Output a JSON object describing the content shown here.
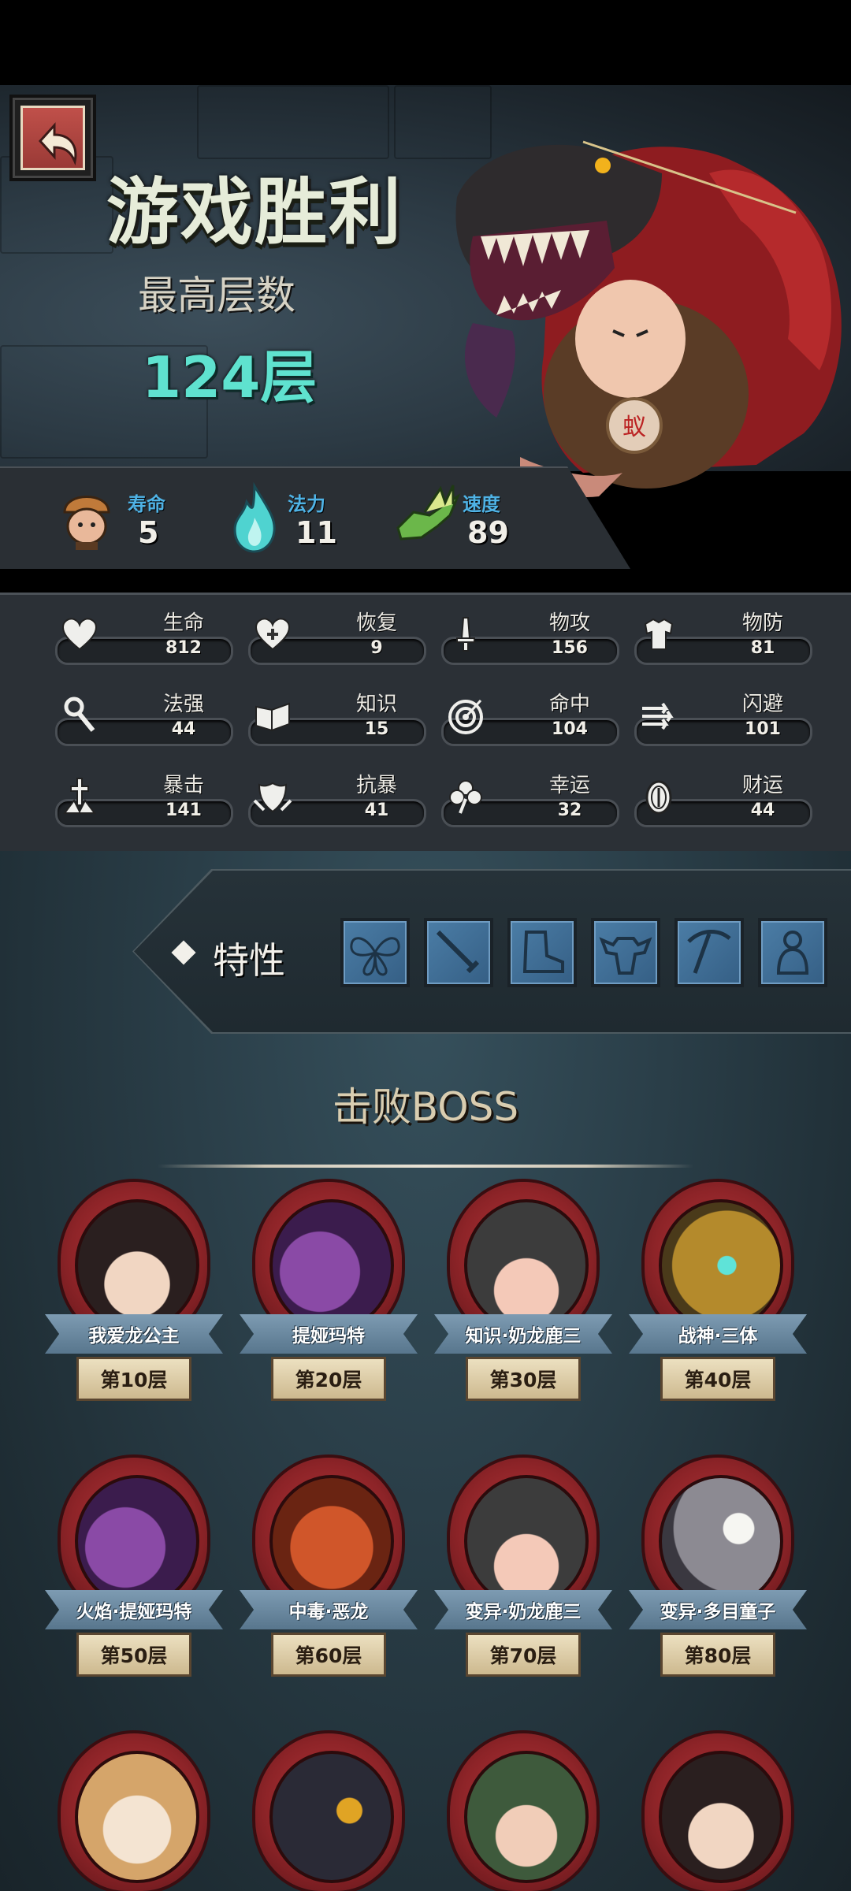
{
  "header": {
    "title": "游戏胜利",
    "floor_label": "最高层数",
    "floor_value": "124层"
  },
  "top_stats": [
    {
      "label": "寿命",
      "value": "5",
      "icon": "helmet-character-icon"
    },
    {
      "label": "法力",
      "value": "11",
      "icon": "blue-flame-icon"
    },
    {
      "label": "速度",
      "value": "89",
      "icon": "winged-boot-icon"
    }
  ],
  "attributes": [
    {
      "label": "生命",
      "value": "812",
      "icon": "heart-icon"
    },
    {
      "label": "恢复",
      "value": "9",
      "icon": "heart-plus-icon"
    },
    {
      "label": "物攻",
      "value": "156",
      "icon": "sword-icon"
    },
    {
      "label": "物防",
      "value": "81",
      "icon": "armor-icon"
    },
    {
      "label": "法强",
      "value": "44",
      "icon": "staff-icon"
    },
    {
      "label": "知识",
      "value": "15",
      "icon": "book-icon"
    },
    {
      "label": "命中",
      "value": "104",
      "icon": "target-icon"
    },
    {
      "label": "闪避",
      "value": "101",
      "icon": "dodge-arrows-icon"
    },
    {
      "label": "暴击",
      "value": "141",
      "icon": "crit-dagger-icon"
    },
    {
      "label": "抗暴",
      "value": "41",
      "icon": "shield-wing-icon"
    },
    {
      "label": "幸运",
      "value": "32",
      "icon": "clover-icon"
    },
    {
      "label": "财运",
      "value": "44",
      "icon": "coin-icon"
    }
  ],
  "traits": {
    "label": "特性",
    "icons": [
      "butterfly-trait-icon",
      "blade-trait-icon",
      "boot-trait-icon",
      "muscle-trait-icon",
      "pickaxe-trait-icon",
      "hero-trait-icon"
    ]
  },
  "boss_section": {
    "title": "击败BOSS",
    "bosses": [
      {
        "name": "我爱龙公主",
        "floor": "第10层",
        "portrait": "princess-portrait",
        "color": "#3a2a2a"
      },
      {
        "name": "提娅玛特",
        "floor": "第20层",
        "portrait": "purple-dragon-portrait",
        "color": "#5a2a6e"
      },
      {
        "name": "知识·奶龙鹿三",
        "floor": "第30层",
        "portrait": "helmet-baby-portrait",
        "color": "#4a4a4a"
      },
      {
        "name": "战神·三体",
        "floor": "第40层",
        "portrait": "golden-robot-portrait",
        "color": "#8a6a20"
      },
      {
        "name": "火焰·提娅玛特",
        "floor": "第50层",
        "portrait": "purple-dragon-portrait",
        "color": "#5a2a6e"
      },
      {
        "name": "中毒·恶龙",
        "floor": "第60层",
        "portrait": "red-dragon-portrait",
        "color": "#9a3a1a"
      },
      {
        "name": "变异·奶龙鹿三",
        "floor": "第70层",
        "portrait": "helmet-baby-portrait",
        "color": "#4a4a4a"
      },
      {
        "name": "变异·多目童子",
        "floor": "第80层",
        "portrait": "multi-eye-portrait",
        "color": "#6a6a72"
      },
      {
        "name": "",
        "floor": "",
        "portrait": "blonde-lady-portrait",
        "color": "#d9b07a"
      },
      {
        "name": "",
        "floor": "",
        "portrait": "dark-bird-portrait",
        "color": "#2a2a3a"
      },
      {
        "name": "",
        "floor": "",
        "portrait": "angry-pirate-portrait",
        "color": "#3a5a3a"
      },
      {
        "name": "",
        "floor": "",
        "portrait": "princess-portrait",
        "color": "#3a2a2a"
      }
    ]
  }
}
